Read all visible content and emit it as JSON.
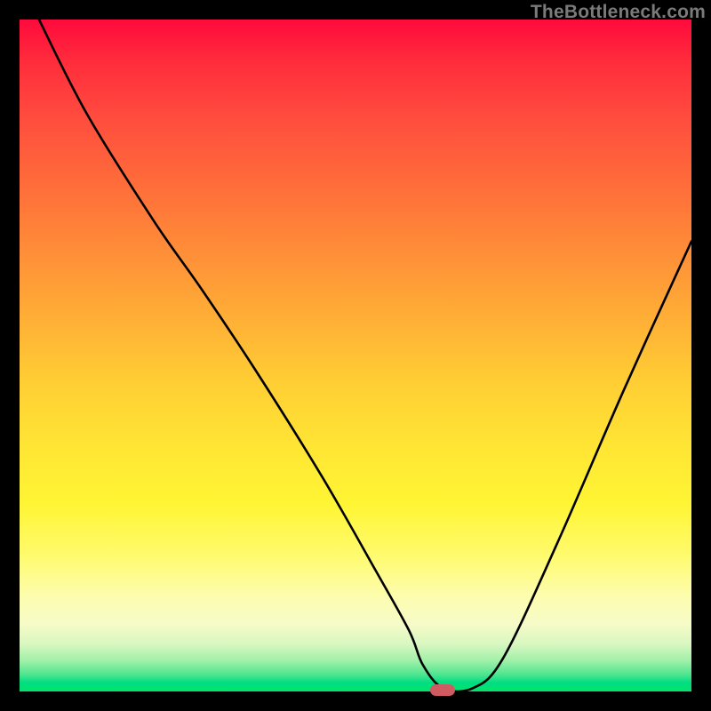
{
  "watermark": "TheBottleneck.com",
  "chart_data": {
    "type": "line",
    "title": "",
    "xlabel": "",
    "ylabel": "",
    "xlim": [
      0,
      100
    ],
    "ylim": [
      0,
      100
    ],
    "grid": false,
    "legend": false,
    "annotations": [],
    "series": [
      {
        "name": "bottleneck-curve",
        "x": [
          2.9,
          10,
          20,
          27,
          35,
          45,
          53,
          58,
          60,
          63,
          67.5,
          72,
          80,
          90,
          100
        ],
        "values": [
          100,
          86,
          70,
          60,
          48,
          32,
          18,
          9,
          4,
          0.5,
          0.5,
          5,
          22,
          45,
          67
        ],
        "color": "#000000"
      }
    ],
    "marker": {
      "x": 63,
      "y": 0.3,
      "color": "#cf5a62"
    },
    "background_gradient": {
      "stops": [
        {
          "pct": 0,
          "color": "#ff0a3c"
        },
        {
          "pct": 24,
          "color": "#ff6b3a"
        },
        {
          "pct": 54,
          "color": "#ffce34"
        },
        {
          "pct": 86,
          "color": "#fdfdb0"
        },
        {
          "pct": 97.5,
          "color": "#4de58f"
        },
        {
          "pct": 100,
          "color": "#00e56a"
        }
      ]
    }
  }
}
